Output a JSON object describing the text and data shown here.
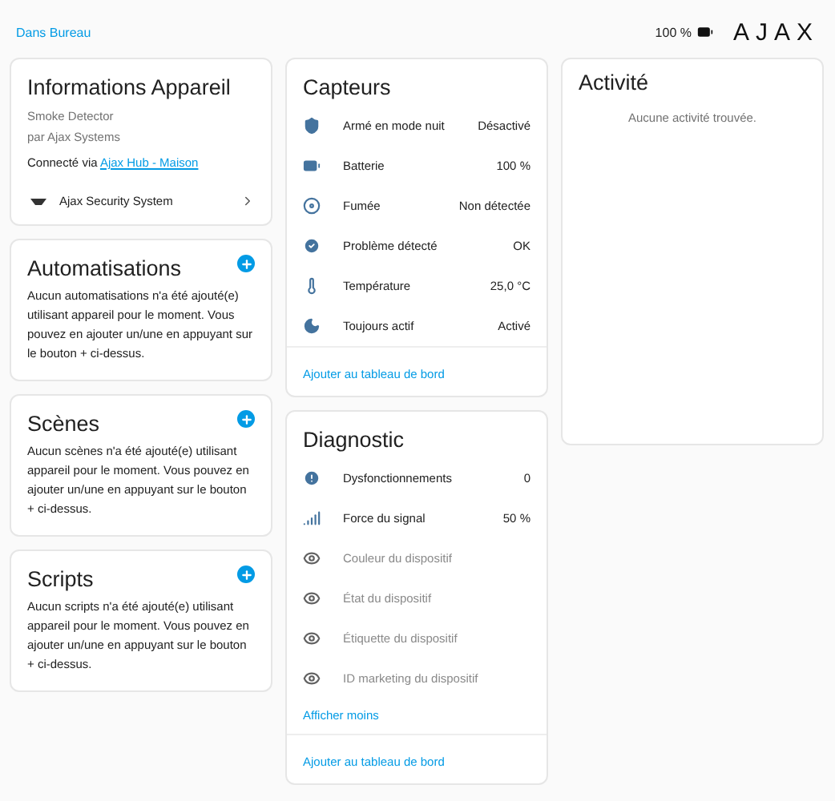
{
  "breadcrumb": "Dans Bureau",
  "battery_reading": "100 %",
  "logo": "AJAX",
  "device_info": {
    "title": "Informations Appareil",
    "model": "Smoke Detector",
    "manufacturer": "par Ajax Systems",
    "connected_prefix": "Connecté via",
    "connected_link": "Ajax Hub - Maison",
    "integration": "Ajax Security System"
  },
  "sections": [
    {
      "title": "Automatisations",
      "text": "Aucun automatisations n'a été ajouté(e) utilisant appareil pour le moment. Vous pouvez en ajouter un/une en appuyant sur le bouton + ci-dessus."
    },
    {
      "title": "Scènes",
      "text": "Aucun scènes n'a été ajouté(e) utilisant appareil pour le moment. Vous pouvez en ajouter un/une en appuyant sur le bouton + ci-dessus."
    },
    {
      "title": "Scripts",
      "text": "Aucun scripts n'a été ajouté(e) utilisant appareil pour le moment. Vous pouvez en ajouter un/une en appuyant sur le bouton + ci-dessus."
    }
  ],
  "sensors": {
    "title": "Capteurs",
    "rows": [
      {
        "label": "Armé en mode nuit",
        "value": "Désactivé",
        "disabled": false
      },
      {
        "label": "Batterie",
        "value": "100 %",
        "disabled": false
      },
      {
        "label": "Fumée",
        "value": "Non détectée",
        "disabled": false
      },
      {
        "label": "Problème détecté",
        "value": "OK",
        "disabled": false
      },
      {
        "label": "Température",
        "value": "25,0 °C",
        "disabled": false
      },
      {
        "label": "Toujours actif",
        "value": "Activé",
        "disabled": false
      }
    ],
    "footer": "Ajouter au tableau de bord"
  },
  "diagnostic": {
    "title": "Diagnostic",
    "rows": [
      {
        "label": "Dysfonctionnements",
        "value": "0",
        "disabled": false
      },
      {
        "label": "Force du signal",
        "value": "50 %",
        "disabled": false
      },
      {
        "label": "Couleur du dispositif",
        "disabled": true
      },
      {
        "label": "État du dispositif",
        "disabled": true
      },
      {
        "label": "Étiquette du dispositif",
        "disabled": true
      },
      {
        "label": "ID marketing du dispositif",
        "disabled": true
      }
    ],
    "toggle": "Afficher moins",
    "footer": "Ajouter au tableau de bord"
  },
  "activity": {
    "title": "Activité",
    "empty": "Aucune activité trouvée."
  }
}
